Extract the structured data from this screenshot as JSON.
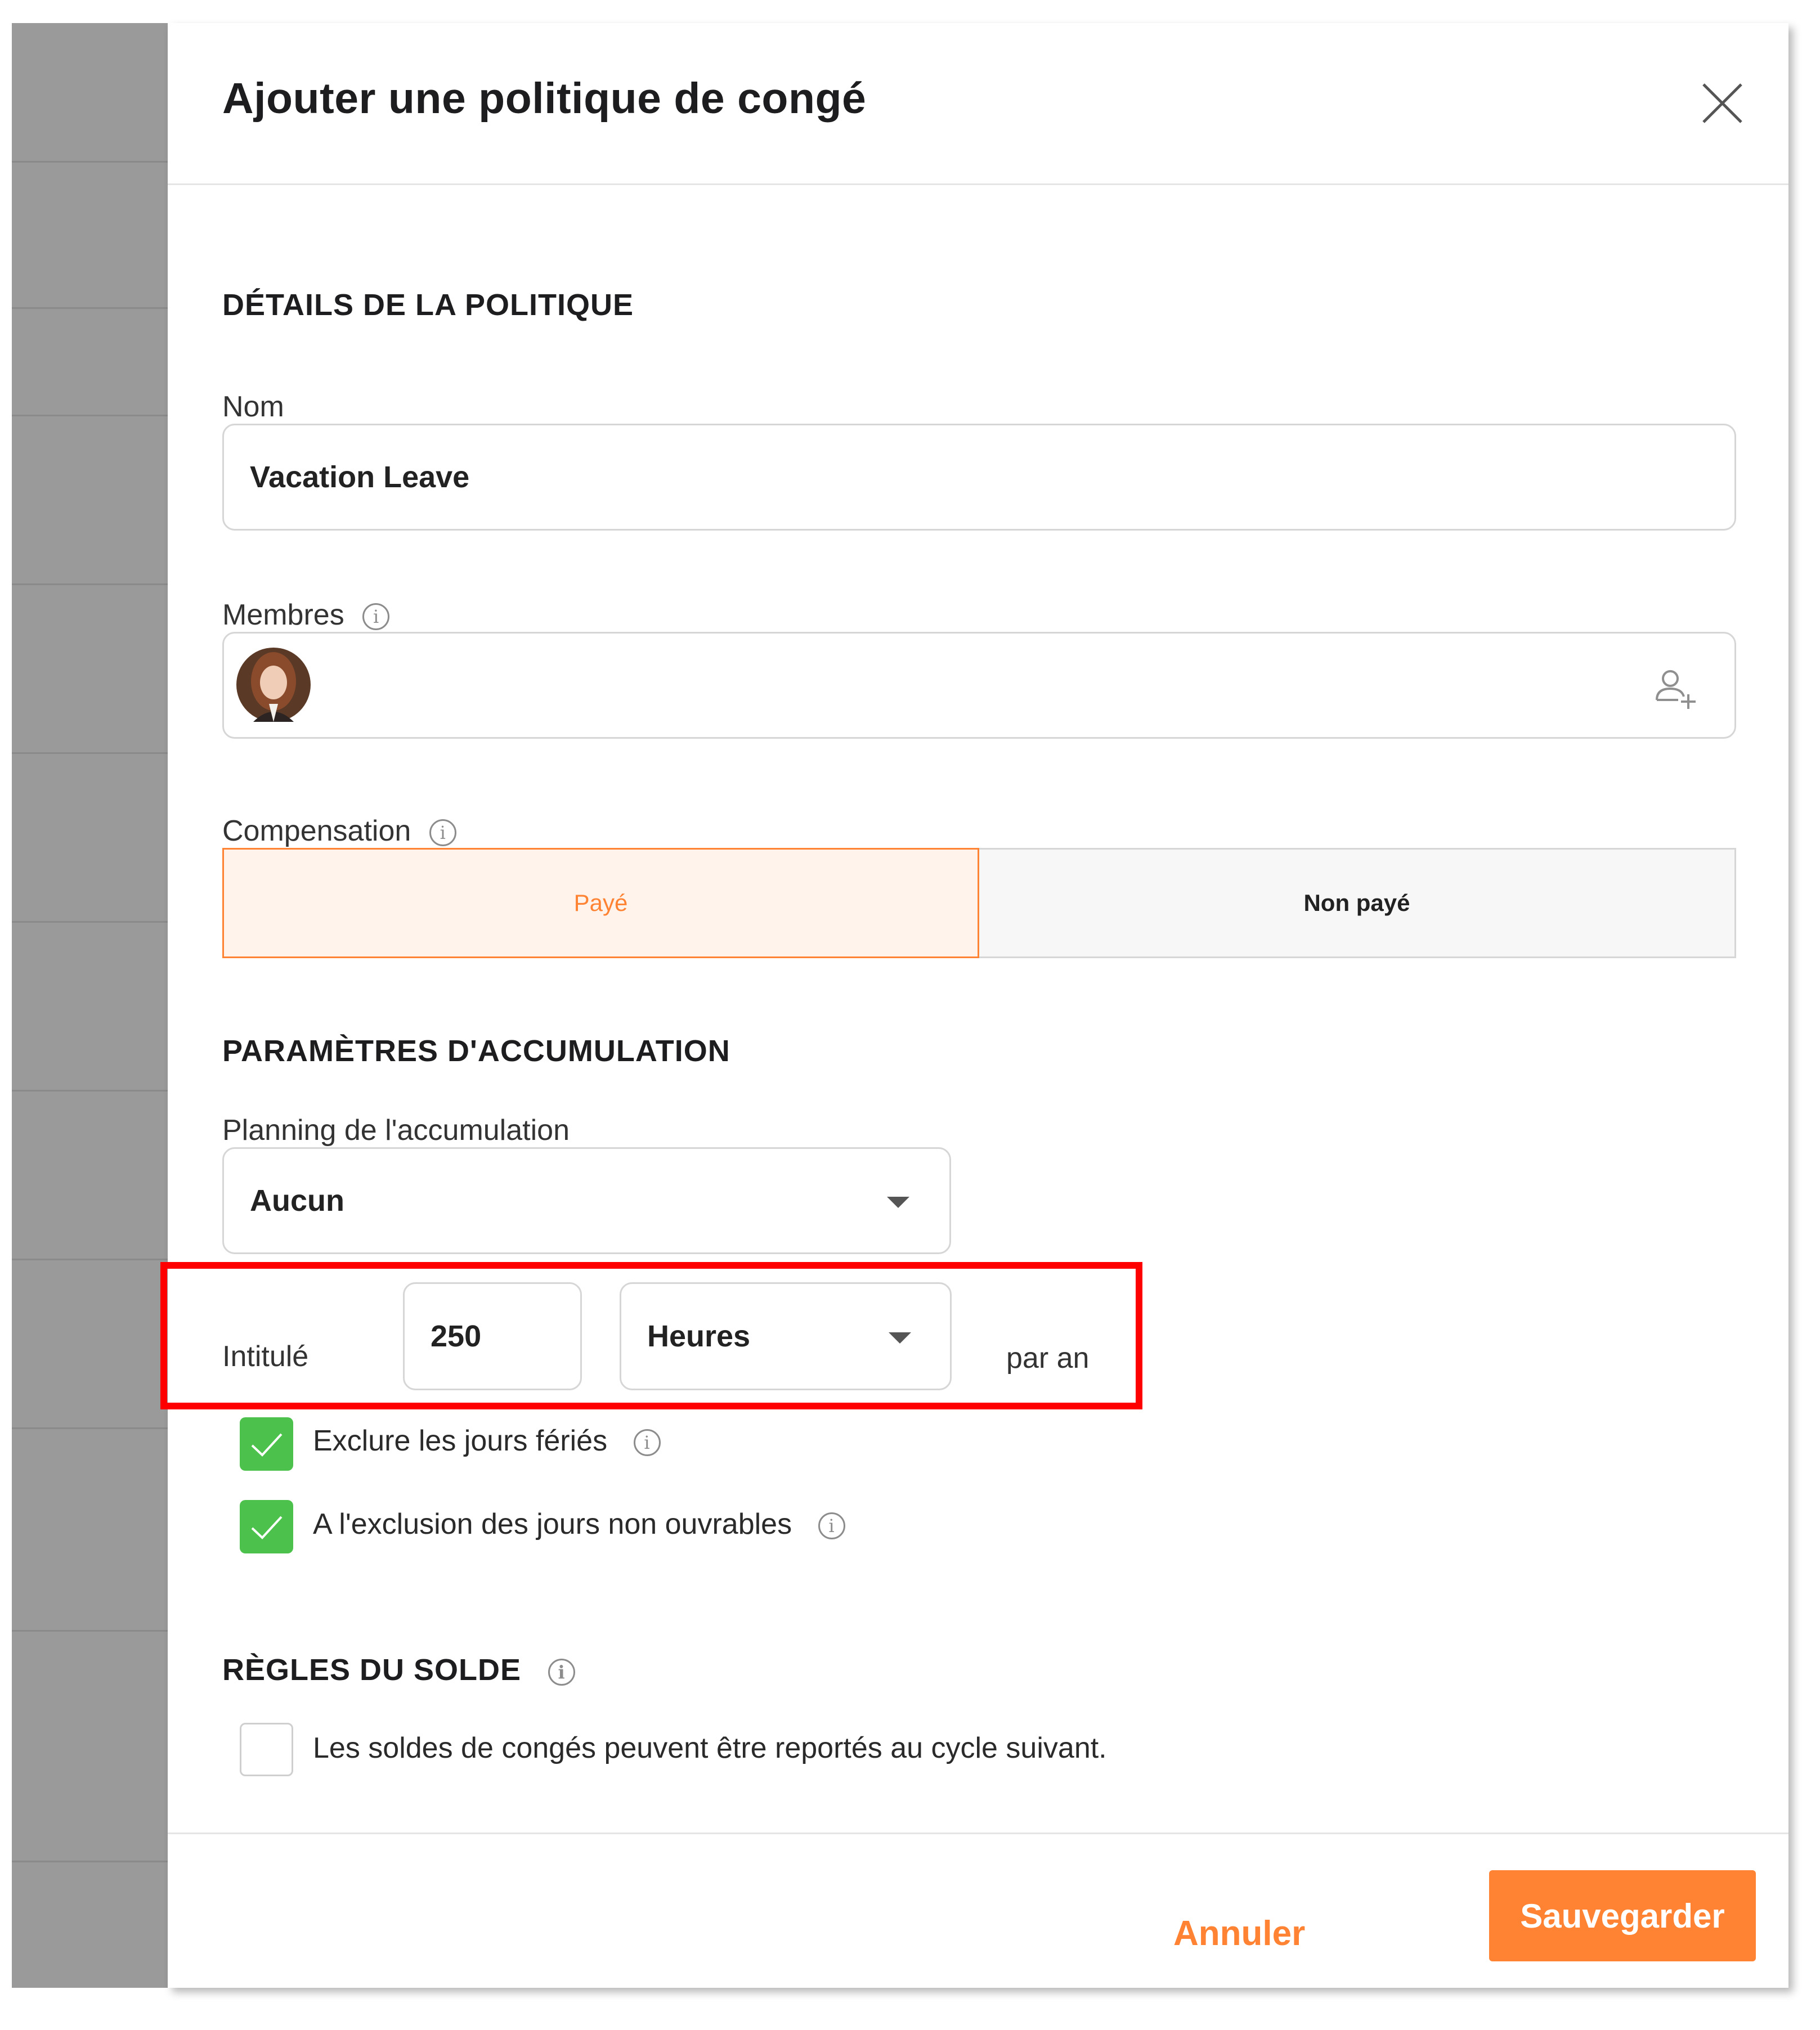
{
  "modal": {
    "title": "Ajouter une politique de congé",
    "close_icon": "close-icon"
  },
  "details": {
    "heading": "DÉTAILS DE LA POLITIQUE",
    "name_label": "Nom",
    "name_value": "Vacation Leave",
    "members_label": "Membres",
    "members_info_icon": "info-icon",
    "add_member_icon": "add-user-icon",
    "compensation_label": "Compensation",
    "compensation_options": [
      "Payé",
      "Non payé"
    ],
    "compensation_selected": "Payé"
  },
  "accumulation": {
    "heading": "PARAMÈTRES D'ACCUMULATION",
    "schedule_label": "Planning de l'accumulation",
    "schedule_value": "Aucun",
    "entitlement_label": "Intitulé",
    "entitlement_amount": "250",
    "entitlement_unit": "Heures",
    "entitlement_period": "par an",
    "exclude_holidays_label": "Exclure les jours fériés",
    "exclude_holidays_checked": true,
    "exclude_nonworking_label": "A l'exclusion des jours non ouvrables",
    "exclude_nonworking_checked": true
  },
  "balance": {
    "heading": "RÈGLES DU SOLDE",
    "carryover_label": "Les soldes de congés peuvent être reportés au cycle suivant.",
    "carryover_checked": false
  },
  "footer": {
    "cancel_label": "Annuler",
    "save_label": "Sauvegarder"
  },
  "colors": {
    "accent": "#ff8333",
    "paid_bg": "#fff3ec",
    "check_green": "#4cc24c",
    "highlight": "#ff0000"
  }
}
